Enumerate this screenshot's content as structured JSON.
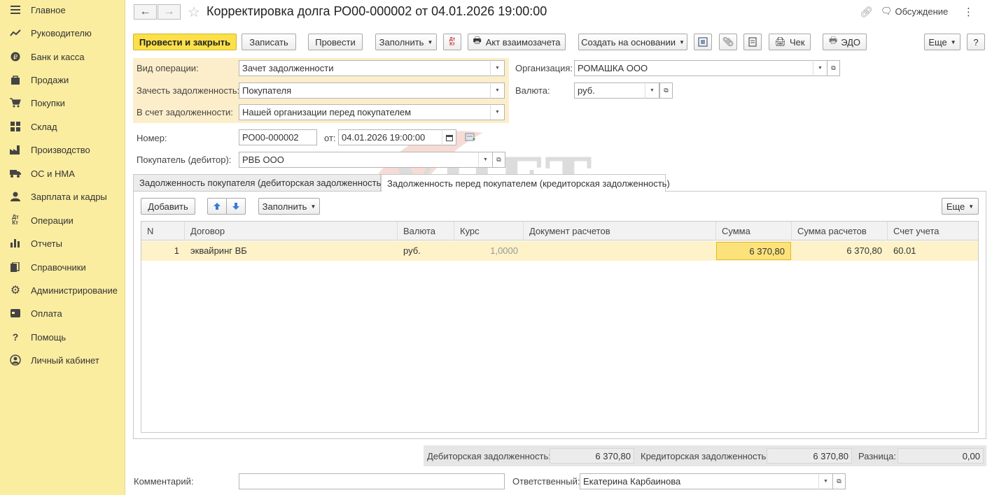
{
  "sidebar": {
    "items": [
      {
        "label": "Главное",
        "icon": "menu-icon"
      },
      {
        "label": "Руководителю",
        "icon": "chart-trend-icon"
      },
      {
        "label": "Банк и касса",
        "icon": "ruble-icon"
      },
      {
        "label": "Продажи",
        "icon": "bag-icon"
      },
      {
        "label": "Покупки",
        "icon": "cart-icon"
      },
      {
        "label": "Склад",
        "icon": "warehouse-icon"
      },
      {
        "label": "Производство",
        "icon": "factory-icon"
      },
      {
        "label": "ОС и НМА",
        "icon": "truck-icon"
      },
      {
        "label": "Зарплата и кадры",
        "icon": "person-icon"
      },
      {
        "label": "Операции",
        "icon": "dt-kt-icon"
      },
      {
        "label": "Отчеты",
        "icon": "bar-chart-icon"
      },
      {
        "label": "Справочники",
        "icon": "books-icon"
      },
      {
        "label": "Администрирование",
        "icon": "gear-icon"
      },
      {
        "label": "Оплата",
        "icon": "card-icon"
      },
      {
        "label": "Помощь",
        "icon": "question-icon"
      },
      {
        "label": "Личный кабинет",
        "icon": "user-circle-icon"
      }
    ]
  },
  "header": {
    "title": "Корректировка долга РО00-000002 от 04.01.2026 19:00:00",
    "discussion": "Обсуждение"
  },
  "toolbar": {
    "post_close": "Провести и закрыть",
    "save": "Записать",
    "post": "Провести",
    "fill": "Заполнить",
    "offset_act": "Акт взаимозачета",
    "create_based": "Создать на основании",
    "check": "Чек",
    "edo": "ЭДО",
    "more": "Еще",
    "help": "?"
  },
  "form": {
    "operation_type_label": "Вид операции:",
    "operation_type": "Зачет задолженности",
    "offset_debt_label": "Зачесть задолженность:",
    "offset_debt": "Покупателя",
    "against_debt_label": "В счет задолженности:",
    "against_debt": "Нашей организации перед покупателем",
    "organization_label": "Организация:",
    "organization": "РОМАШКА ООО",
    "currency_label": "Валюта:",
    "currency": "руб.",
    "number_label": "Номер:",
    "number": "РО00-000002",
    "date_label": "от:",
    "date": "04.01.2026 19:00:00",
    "buyer_label": "Покупатель (дебитор):",
    "buyer": "РВБ ООО"
  },
  "tabs": [
    {
      "label": "Задолженность покупателя (дебиторская задолженность)",
      "active": false
    },
    {
      "label": "Задолженность перед покупателем (кредиторская задолженность)",
      "active": true
    }
  ],
  "table_toolbar": {
    "add": "Добавить",
    "fill": "Заполнить",
    "more": "Еще"
  },
  "table": {
    "columns": [
      "N",
      "Договор",
      "Валюта",
      "Курс",
      "Документ расчетов",
      "Сумма",
      "Сумма расчетов",
      "Счет учета"
    ],
    "rows": [
      {
        "n": "1",
        "contract": "эквайринг ВБ",
        "currency": "руб.",
        "rate": "1,0000",
        "doc": "",
        "sum": "6 370,80",
        "settle_sum": "6 370,80",
        "account": "60.01"
      }
    ]
  },
  "totals": {
    "receivable_label": "Дебиторская задолженность:",
    "receivable": "6 370,80",
    "payable_label": "Кредиторская задолженность:",
    "payable": "6 370,80",
    "diff_label": "Разница:",
    "diff": "0,00"
  },
  "footer": {
    "comment_label": "Комментарий:",
    "comment": "",
    "responsible_label": "Ответственный:",
    "responsible": "Екатерина Карбаинова"
  },
  "watermark": {
    "line1": "УЧЕТ",
    "line2": "БЕЗ ЗАБОТ"
  },
  "colors": {
    "sidebar_bg": "#fbeda0",
    "primary_button": "#fbe04a",
    "highlight_block": "#fdeecb",
    "selected_row": "#fdf2c8"
  }
}
